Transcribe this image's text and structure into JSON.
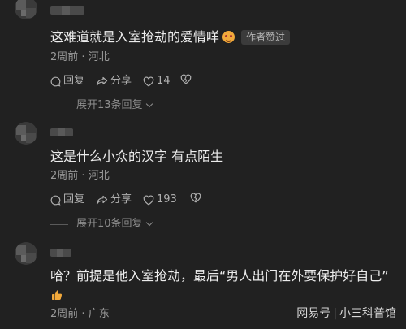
{
  "comments": [
    {
      "text": "这难道就是入室抢劫的爱情咩",
      "author_tag": "作者赞过",
      "emoji": "star-struck-face",
      "time": "2周前",
      "location": "河北",
      "reply_label": "回复",
      "share_label": "分享",
      "likes": "14",
      "more_replies": "展开13条回复"
    },
    {
      "text": "这是什么小众的汉字 有点陌生",
      "time": "2周前",
      "location": "河北",
      "reply_label": "回复",
      "share_label": "分享",
      "likes": "193",
      "more_replies": "展开10条回复"
    },
    {
      "text": "哈？前提是他入室抢劫，最后“男人出门在外要保护好自己”",
      "emoji": "thumbs-up",
      "time": "2周前",
      "location": "广东"
    }
  ],
  "meta_separator": "·",
  "watermark": {
    "left": "网易号",
    "separator": "|",
    "right": "小三科普馆"
  }
}
